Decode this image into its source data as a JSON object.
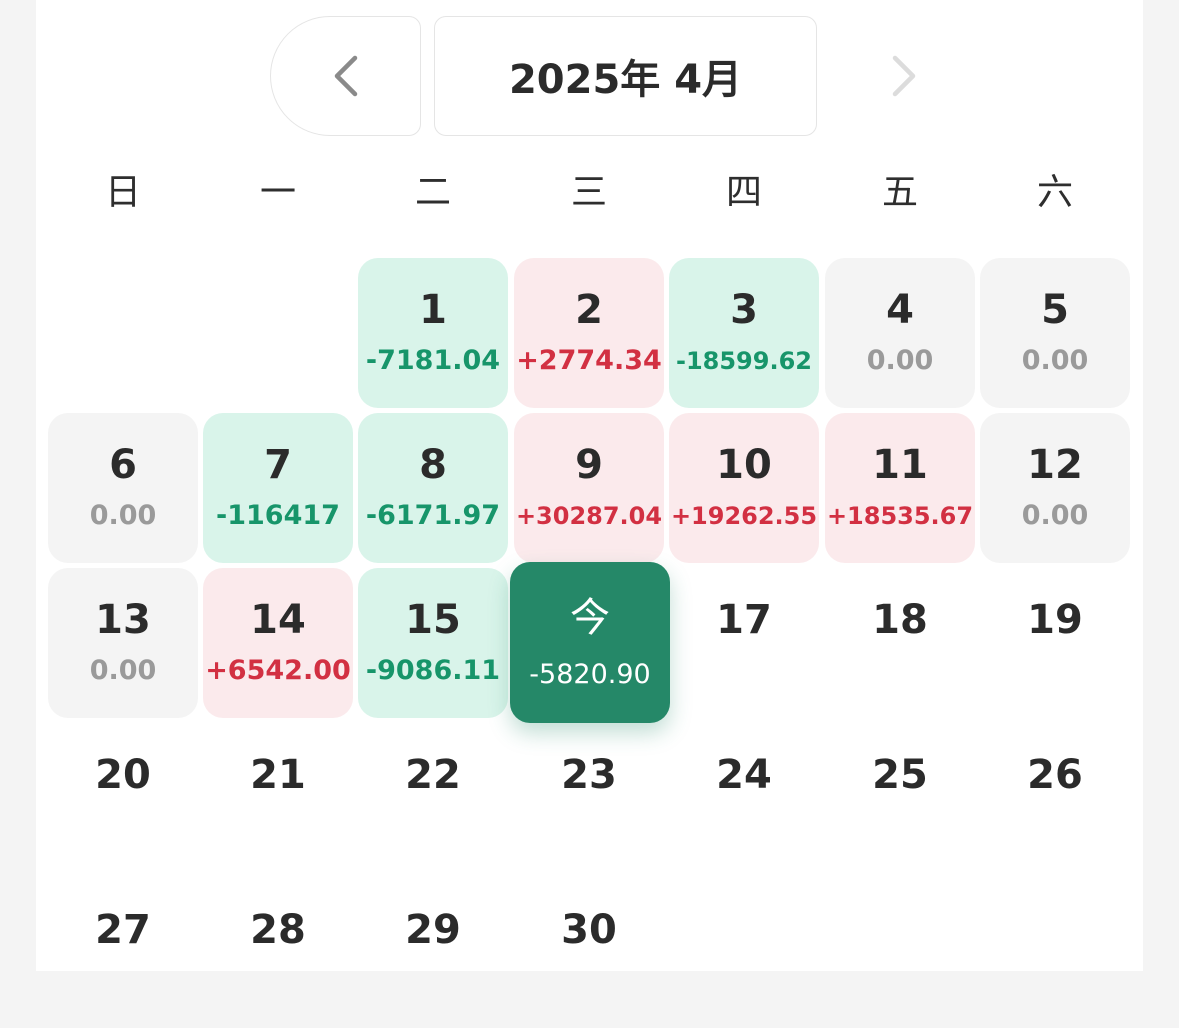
{
  "header": {
    "month_label": "2025年 4月"
  },
  "weekdays": [
    "日",
    "一",
    "二",
    "三",
    "四",
    "五",
    "六"
  ],
  "days": [
    {
      "num": "1",
      "amt": "-7181.04",
      "kind": "loss"
    },
    {
      "num": "2",
      "amt": "+2774.34",
      "kind": "gain"
    },
    {
      "num": "3",
      "amt": "-18599.62",
      "kind": "loss"
    },
    {
      "num": "4",
      "amt": "0.00",
      "kind": "zero"
    },
    {
      "num": "5",
      "amt": "0.00",
      "kind": "zero"
    },
    {
      "num": "6",
      "amt": "0.00",
      "kind": "zero"
    },
    {
      "num": "7",
      "amt": "-116417",
      "kind": "loss"
    },
    {
      "num": "8",
      "amt": "-6171.97",
      "kind": "loss"
    },
    {
      "num": "9",
      "amt": "+30287.04",
      "kind": "gain"
    },
    {
      "num": "10",
      "amt": "+19262.55",
      "kind": "gain"
    },
    {
      "num": "11",
      "amt": "+18535.67",
      "kind": "gain"
    },
    {
      "num": "12",
      "amt": "0.00",
      "kind": "zero"
    },
    {
      "num": "13",
      "amt": "0.00",
      "kind": "zero"
    },
    {
      "num": "14",
      "amt": "+6542.00",
      "kind": "gain"
    },
    {
      "num": "15",
      "amt": "-9086.11",
      "kind": "loss"
    },
    {
      "num": "今",
      "amt": "-5820.90",
      "kind": "today"
    },
    {
      "num": "17",
      "amt": "",
      "kind": "empty"
    },
    {
      "num": "18",
      "amt": "",
      "kind": "empty"
    },
    {
      "num": "19",
      "amt": "",
      "kind": "empty"
    },
    {
      "num": "20",
      "amt": "",
      "kind": "empty"
    },
    {
      "num": "21",
      "amt": "",
      "kind": "empty"
    },
    {
      "num": "22",
      "amt": "",
      "kind": "empty"
    },
    {
      "num": "23",
      "amt": "",
      "kind": "empty"
    },
    {
      "num": "24",
      "amt": "",
      "kind": "empty"
    },
    {
      "num": "25",
      "amt": "",
      "kind": "empty"
    },
    {
      "num": "26",
      "amt": "",
      "kind": "empty"
    },
    {
      "num": "27",
      "amt": "",
      "kind": "empty"
    },
    {
      "num": "28",
      "amt": "",
      "kind": "empty"
    },
    {
      "num": "29",
      "amt": "",
      "kind": "empty"
    },
    {
      "num": "30",
      "amt": "",
      "kind": "empty"
    }
  ],
  "colors": {
    "gain_text": "#d23042",
    "gain_bg": "#fbeaec",
    "loss_text": "#17956a",
    "loss_bg": "#d9f4ea",
    "zero_bg": "#f4f4f4",
    "today_bg": "#258868"
  },
  "icons": {
    "prev": "chevron-left-icon",
    "next": "chevron-right-icon"
  }
}
